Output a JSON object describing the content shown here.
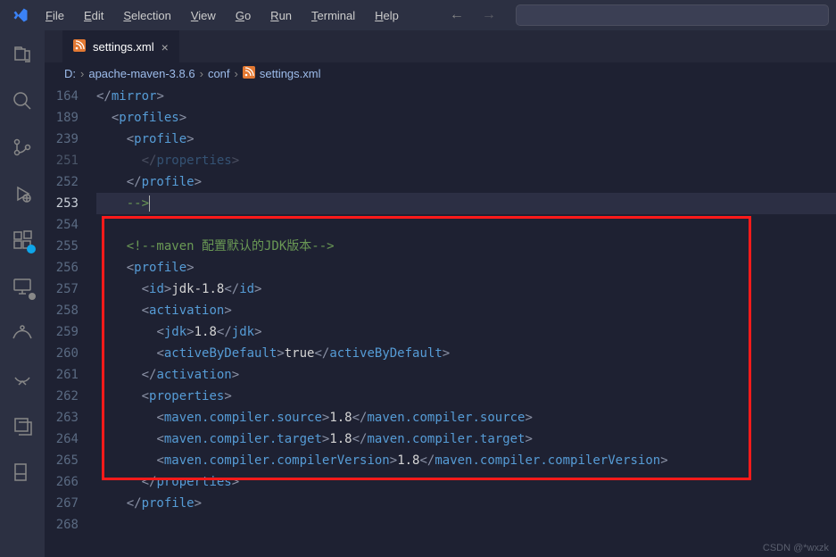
{
  "menu": {
    "file": "File",
    "edit": "Edit",
    "selection": "Selection",
    "view": "View",
    "go": "Go",
    "run": "Run",
    "terminal": "Terminal",
    "help": "Help"
  },
  "tab": {
    "filename": "settings.xml",
    "close": "×"
  },
  "breadcrumbs": {
    "drive": "D:",
    "folder1": "apache-maven-3.8.6",
    "folder2": "conf",
    "file": "settings.xml"
  },
  "line_numbers": [
    "164",
    "189",
    "239",
    "251",
    "252",
    "253",
    "254",
    "255",
    "256",
    "257",
    "258",
    "259",
    "260",
    "261",
    "262",
    "263",
    "264",
    "265",
    "266",
    "267",
    "268"
  ],
  "active_line": "253",
  "faded_line": "251",
  "code": {
    "l164": {
      "close_tag": "mirror"
    },
    "l189": {
      "open_tag": "profiles"
    },
    "l239": {
      "open_tag": "profile"
    },
    "l251": {
      "close_tag": "properties"
    },
    "l252": {
      "close_tag": "profile"
    },
    "l253": {
      "text": "-->"
    },
    "l255_comment": "<!--maven 配置默认的JDK版本-->",
    "l256": {
      "open_tag": "profile"
    },
    "l257": {
      "open": "id",
      "text": "jdk-1.8",
      "close": "id"
    },
    "l258": {
      "open_tag": "activation"
    },
    "l259": {
      "open": "jdk",
      "text": "1.8",
      "close": "jdk"
    },
    "l260": {
      "open": "activeByDefault",
      "text": "true",
      "close": "activeByDefault"
    },
    "l261": {
      "close_tag": "activation"
    },
    "l262": {
      "open_tag": "properties"
    },
    "l263": {
      "open": "maven.compiler.source",
      "text": "1.8",
      "close": "maven.compiler.source"
    },
    "l264": {
      "open": "maven.compiler.target",
      "text": "1.8",
      "close": "maven.compiler.target"
    },
    "l265": {
      "open": "maven.compiler.compilerVersion",
      "text": "1.8",
      "close": "maven.compiler.compilerVersion"
    },
    "l266": {
      "close_tag": "properties"
    },
    "l267": {
      "close_tag": "profile"
    }
  },
  "watermark": "CSDN @*wxzk"
}
